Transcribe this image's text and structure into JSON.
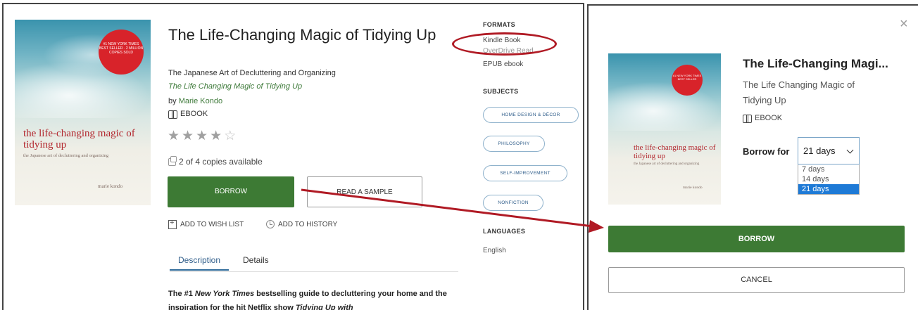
{
  "left": {
    "cover": {
      "seal_text": "#1 NEW YORK TIMES BEST SELLER · 2 MILLION COPIES SOLD",
      "title": "the life-changing magic of tidying up",
      "subtitle": "the Japanese art of decluttering and organizing",
      "author": "marie kondo"
    },
    "book_title": "The Life-Changing Magic of Tidying Up",
    "subtitle": "The Japanese Art of Decluttering and Organizing",
    "series": "The Life Changing Magic of Tidying Up",
    "by_prefix": "by ",
    "author": "Marie Kondo",
    "format_label": "EBOOK",
    "rating": 4,
    "rating_max": 5,
    "copies": "2 of 4 copies available",
    "borrow_label": "BORROW",
    "sample_label": "READ A SAMPLE",
    "wishlist_label": "ADD TO WISH LIST",
    "history_label": "ADD TO HISTORY",
    "tabs": [
      {
        "label": "Description"
      },
      {
        "label": "Details"
      }
    ],
    "description": {
      "part1": "The #1 ",
      "italic1": "New York Times",
      "part2": " bestselling guide to decluttering your home and the inspiration for the hit Netflix show ",
      "italic2": "Tidying Up with"
    },
    "formats_heading": "FORMATS",
    "formats": [
      "Kindle Book",
      "OverDrive Read",
      "EPUB ebook"
    ],
    "subjects_heading": "SUBJECTS",
    "subjects": [
      "HOME DESIGN & DÉCOR",
      "PHILOSOPHY",
      "SELF-IMPROVEMENT",
      "NONFICTION"
    ],
    "languages_heading": "LANGUAGES",
    "language": "English"
  },
  "modal": {
    "close_symbol": "×",
    "title": "The Life-Changing Magi...",
    "series": "The Life Changing Magic of Tidying Up",
    "format_label": "EBOOK",
    "borrow_for_label": "Borrow for",
    "selected_period": "21 days",
    "period_options": [
      "7 days",
      "14 days",
      "21 days"
    ],
    "borrow_label": "BORROW",
    "cancel_label": "CANCEL",
    "cover": {
      "seal_text": "#1 NEW YORK TIMES BEST SELLER",
      "title": "the life-changing magic of tidying up",
      "subtitle": "the Japanese art of decluttering and organizing",
      "author": "marie kondo"
    }
  },
  "colors": {
    "borrow_green": "#3d7a34",
    "annotation_red": "#b01a24",
    "link_blue": "#2f5d8a",
    "selected_option_blue": "#1e7ad6"
  },
  "icons": [
    "book-icon",
    "star-icon",
    "copies-icon",
    "bookmark-icon",
    "clock-icon",
    "close-icon",
    "chevron-down-icon"
  ]
}
